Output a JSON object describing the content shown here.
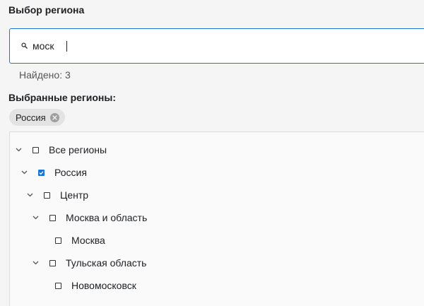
{
  "header": {
    "title": "Выбор региона"
  },
  "search": {
    "value": "моск",
    "icon": "search-icon"
  },
  "results": {
    "found_text": "Найдено: 3"
  },
  "selected": {
    "label": "Выбранные регионы:",
    "chips": [
      {
        "label": "Россия",
        "icon": "close-circle-icon"
      }
    ]
  },
  "tree": {
    "accent_color": "#1976d2",
    "nodes": [
      {
        "label": "Все регионы",
        "depth": 0,
        "expanded": true,
        "has_children": true,
        "checked": false
      },
      {
        "label": "Россия",
        "depth": 1,
        "expanded": true,
        "has_children": true,
        "checked": true
      },
      {
        "label": "Центр",
        "depth": 2,
        "expanded": true,
        "has_children": true,
        "checked": false
      },
      {
        "label": "Москва и область",
        "depth": 3,
        "expanded": true,
        "has_children": true,
        "checked": false
      },
      {
        "label": "Москва",
        "depth": 4,
        "expanded": false,
        "has_children": false,
        "checked": false
      },
      {
        "label": "Тульская область",
        "depth": 3,
        "expanded": true,
        "has_children": true,
        "checked": false
      },
      {
        "label": "Новомосковск",
        "depth": 4,
        "expanded": false,
        "has_children": false,
        "checked": false
      }
    ]
  }
}
